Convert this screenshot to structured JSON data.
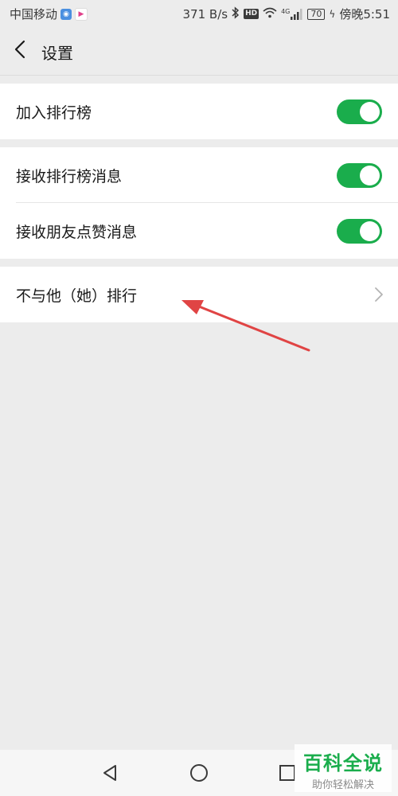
{
  "status_bar": {
    "carrier": "中国移动",
    "net_speed": "371 B/s",
    "hd": "HD",
    "network_type": "4G",
    "battery": "70",
    "time": "傍晚5:51",
    "icons": [
      "signal-app-badge-icon",
      "video-app-badge-icon",
      "bluetooth-icon",
      "wifi-icon",
      "cell-signal-icon",
      "charging-icon"
    ]
  },
  "header": {
    "title": "设置",
    "back_icon": "chevron-left-icon"
  },
  "groups": [
    {
      "items": [
        {
          "label": "加入排行榜",
          "control": "toggle",
          "on": true
        }
      ]
    },
    {
      "items": [
        {
          "label": "接收排行榜消息",
          "control": "toggle",
          "on": true
        },
        {
          "label": "接收朋友点赞消息",
          "control": "toggle",
          "on": true
        }
      ]
    },
    {
      "items": [
        {
          "label": "不与他（她）排行",
          "control": "chevron"
        }
      ]
    }
  ],
  "nav_bar": {
    "buttons": [
      "back-triangle-icon",
      "home-circle-icon",
      "recents-square-icon"
    ]
  },
  "watermark": {
    "main": "百科全说",
    "sub": "助你轻松解决"
  },
  "colors": {
    "accent": "#1aad4c",
    "background": "#ececec",
    "annotation_arrow": "#e04444"
  }
}
